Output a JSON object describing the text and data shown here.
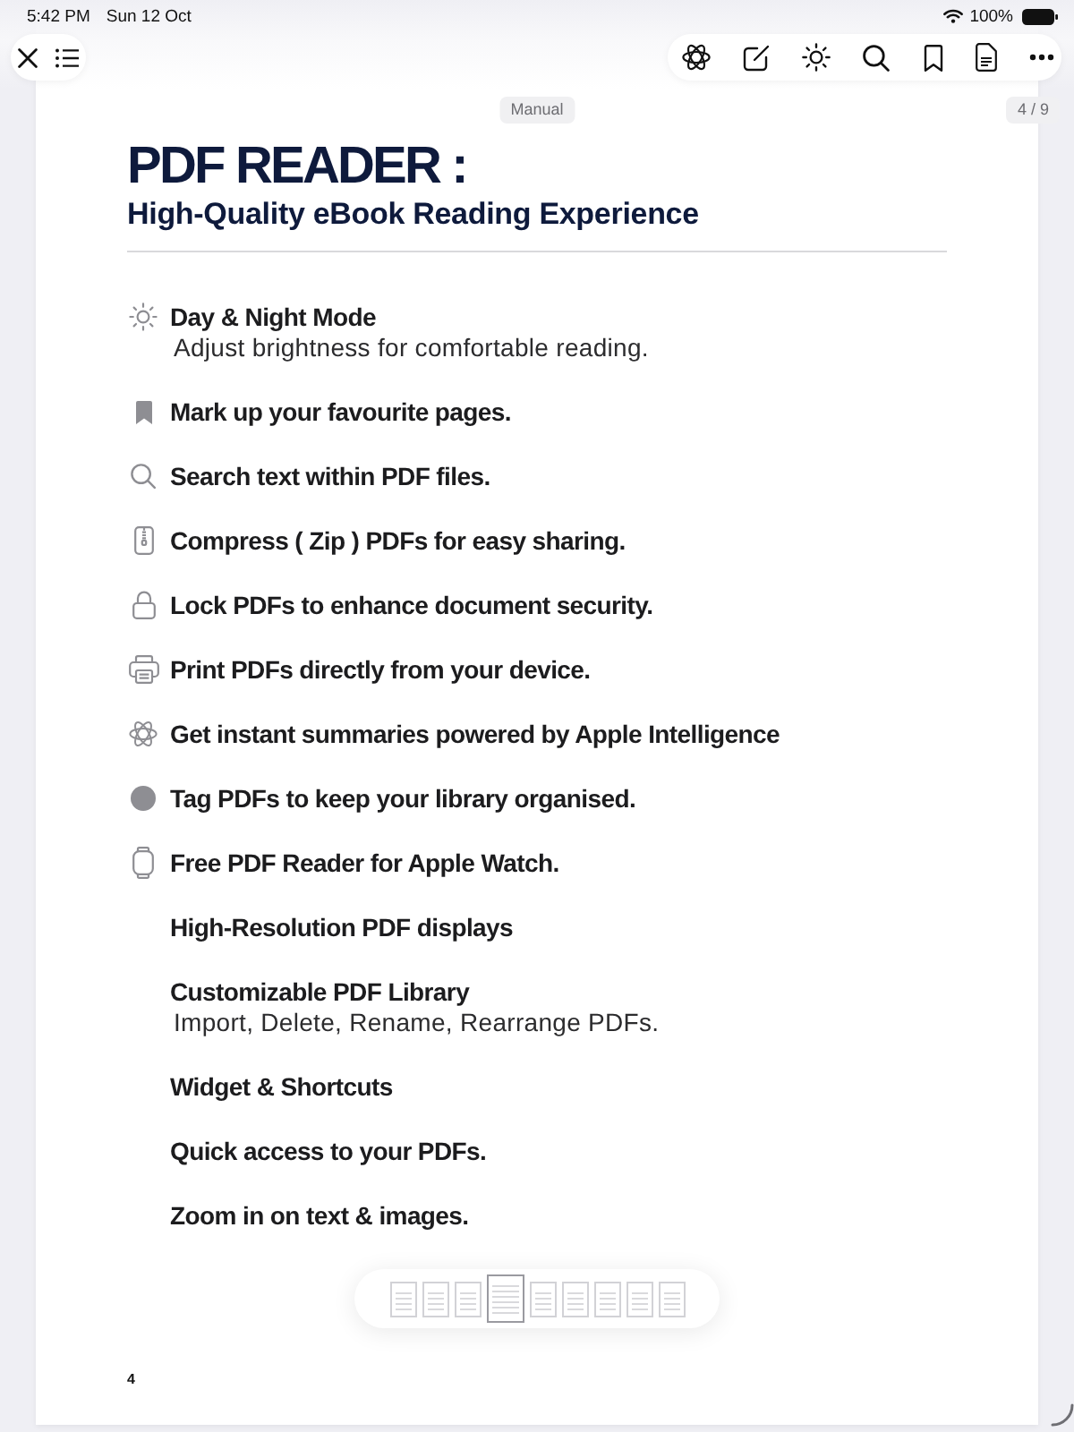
{
  "status_bar": {
    "time": "5:42 PM",
    "date": "Sun 12 Oct",
    "battery": "100%"
  },
  "document": {
    "label": "Manual",
    "page_indicator": "4 / 9",
    "title": "PDF READER :",
    "subtitle": "High-Quality eBook Reading Experience",
    "features": [
      {
        "title": "Day & Night Mode",
        "detail": "Adjust brightness for comfortable reading."
      },
      {
        "title": "Mark up your favourite pages."
      },
      {
        "title": "Search text within PDF files."
      },
      {
        "title": "Compress ( Zip ) PDFs for easy sharing."
      },
      {
        "title": "Lock PDFs to enhance document security."
      },
      {
        "title": "Print PDFs directly from your device."
      },
      {
        "title": "Get instant summaries powered by Apple Intelligence"
      },
      {
        "title": "Tag PDFs to keep your library organised."
      },
      {
        "title": "Free PDF Reader for Apple Watch."
      },
      {
        "title": "High-Resolution PDF displays"
      },
      {
        "title": "Customizable PDF Library",
        "detail": "Import, Delete, Rename, Rearrange PDFs."
      },
      {
        "title": "Widget & Shortcuts"
      },
      {
        "title": "Quick access to your PDFs."
      },
      {
        "title": "Zoom in on text & images."
      }
    ],
    "page_number": "4"
  },
  "thumbnails": [
    {
      "selected": false
    },
    {
      "selected": false
    },
    {
      "selected": false
    },
    {
      "selected": true
    },
    {
      "selected": false
    },
    {
      "selected": false
    },
    {
      "selected": false
    },
    {
      "selected": false
    },
    {
      "selected": false
    }
  ]
}
